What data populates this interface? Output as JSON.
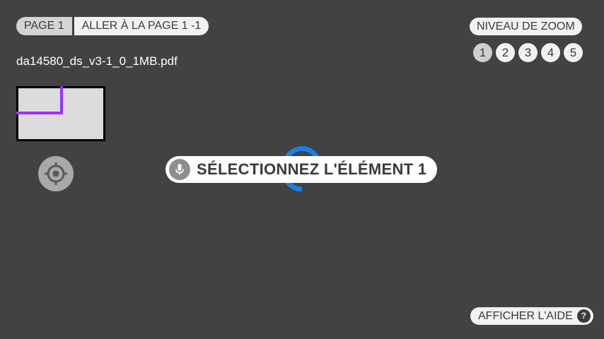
{
  "page_nav": {
    "current_page": "PAGE 1",
    "goto_label": "ALLER À LA PAGE 1 -1"
  },
  "document": {
    "filename": "da14580_ds_v3-1_0_1MB.pdf"
  },
  "zoom": {
    "title": "NIVEAU DE ZOOM",
    "levels": [
      "1",
      "2",
      "3",
      "4",
      "5"
    ],
    "active_level": "1"
  },
  "prompt": {
    "text": "SÉLECTIONNEZ L'ÉLÉMENT 1",
    "icon": "microphone-icon"
  },
  "help": {
    "label": "AFFICHER L'AIDE",
    "icon_glyph": "?"
  },
  "thumbnail": {
    "icon": "page-minimap"
  },
  "recenter": {
    "icon": "crosshair-icon"
  },
  "colors": {
    "background": "#424242",
    "viewport_frame": "#9b30ff",
    "spinner": "#1a7fe8",
    "pill_light": "#f1f1f1",
    "pill_dark": "#d4d4d4"
  }
}
